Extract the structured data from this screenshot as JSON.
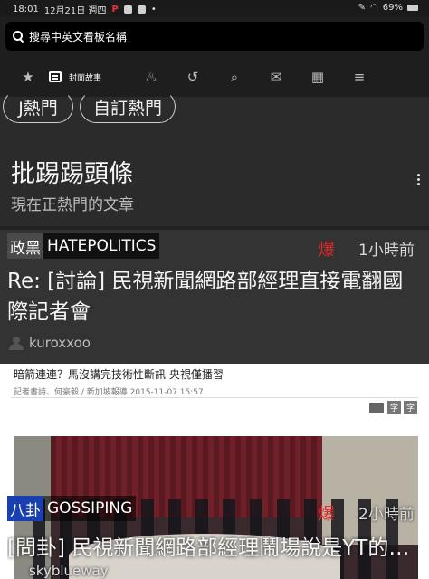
{
  "status_bar": {
    "time": "18:01",
    "date": "12月21日 週四",
    "battery": "69%"
  },
  "search": {
    "placeholder": "搜尋中英文看板名稱"
  },
  "nav": {
    "items": [
      {
        "icon": "star-icon"
      },
      {
        "icon": "cover-story-icon",
        "label": "封面故事"
      },
      {
        "icon": "fire-icon"
      },
      {
        "icon": "history-icon"
      },
      {
        "icon": "search-icon"
      },
      {
        "icon": "mail-icon"
      },
      {
        "icon": "grid-icon"
      },
      {
        "icon": "menu-icon"
      }
    ]
  },
  "tags": [
    "J熱門",
    "自訂熱門"
  ],
  "section": {
    "title": "批踢踢頭條",
    "subtitle": "現在正熱門的文章"
  },
  "posts": [
    {
      "board_tag": "政黑",
      "board_name": "HATEPOLITICS",
      "hot": "爆",
      "time": "1小時前",
      "title": "Re: [討論] 民視新聞網路部經理直接電翻國際記者會",
      "author": "kuroxxoo"
    },
    {
      "board_tag": "八卦",
      "board_name": "GOSSIPING",
      "hot": "爆",
      "time": "2小時前",
      "title": "[問卦] 民視新聞網路部經理鬧場說是YT的…",
      "author": "skyblueway",
      "preview": {
        "headline": "暗箭連連？馬沒講完技術性斷訊 央視僅播習",
        "meta": "記者書詩、何豪毅 / 新加坡報導 2015-11-07 15:57",
        "tool1": "字",
        "tool2": "字"
      }
    }
  ],
  "colors": {
    "background": "#2b2b2b",
    "hot": "#e02828",
    "gossip_tag": "#1a3fb0"
  }
}
